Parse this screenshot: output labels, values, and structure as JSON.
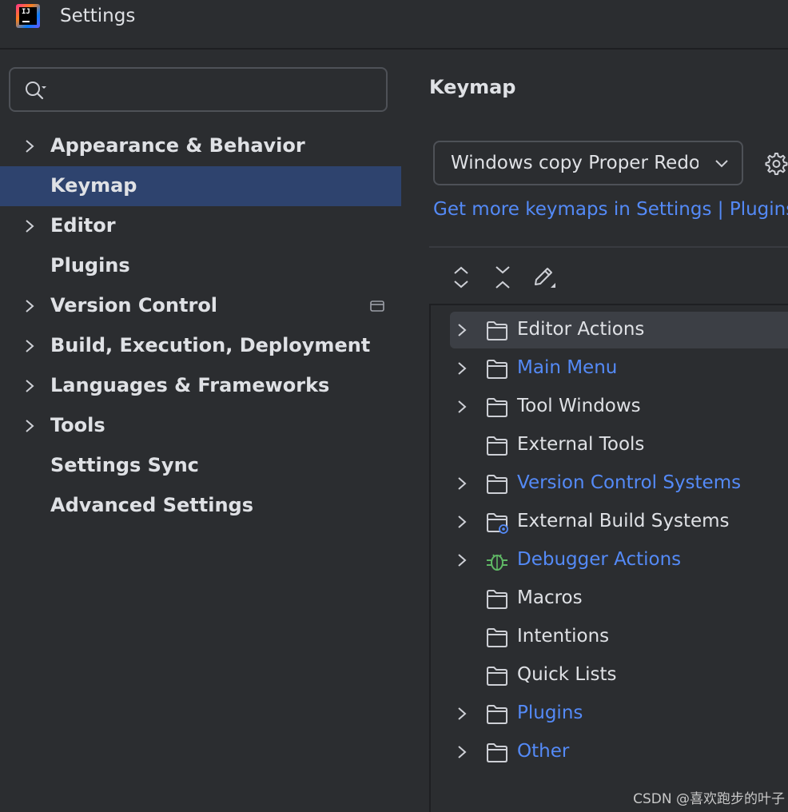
{
  "window": {
    "title": "Settings"
  },
  "search": {
    "placeholder": "",
    "value": ""
  },
  "sidebar": {
    "items": [
      {
        "label": "Appearance & Behavior",
        "expandable": true
      },
      {
        "label": "Keymap",
        "expandable": false,
        "selected": true
      },
      {
        "label": "Editor",
        "expandable": true
      },
      {
        "label": "Plugins",
        "expandable": false
      },
      {
        "label": "Version Control",
        "expandable": true
      },
      {
        "label": "Build, Execution, Deployment",
        "expandable": true
      },
      {
        "label": "Languages & Frameworks",
        "expandable": true
      },
      {
        "label": "Tools",
        "expandable": true
      },
      {
        "label": "Settings Sync",
        "expandable": false
      },
      {
        "label": "Advanced Settings",
        "expandable": false
      }
    ]
  },
  "main": {
    "title": "Keymap",
    "keymap_select": {
      "value": "Windows copy Proper Redo"
    },
    "link": "Get more keymaps in Settings | Plugins",
    "toolbar": {
      "expand_all_icon": "expand-all-icon",
      "collapse_all_icon": "collapse-all-icon",
      "edit_icon": "edit-shortcut-icon"
    },
    "tree": [
      {
        "label": "Editor Actions",
        "expandable": true,
        "modified": false,
        "icon": "folder-icon",
        "highlighted": true
      },
      {
        "label": "Main Menu",
        "expandable": true,
        "modified": true,
        "icon": "folder-icon"
      },
      {
        "label": "Tool Windows",
        "expandable": true,
        "modified": false,
        "icon": "folder-icon"
      },
      {
        "label": "External Tools",
        "expandable": false,
        "modified": false,
        "icon": "folder-icon"
      },
      {
        "label": "Version Control Systems",
        "expandable": true,
        "modified": true,
        "icon": "folder-icon"
      },
      {
        "label": "External Build Systems",
        "expandable": true,
        "modified": false,
        "icon": "folder-gear-icon"
      },
      {
        "label": "Debugger Actions",
        "expandable": true,
        "modified": true,
        "icon": "bug-icon"
      },
      {
        "label": "Macros",
        "expandable": false,
        "modified": false,
        "icon": "folder-icon"
      },
      {
        "label": "Intentions",
        "expandable": false,
        "modified": false,
        "icon": "folder-icon"
      },
      {
        "label": "Quick Lists",
        "expandable": false,
        "modified": false,
        "icon": "folder-icon"
      },
      {
        "label": "Plugins",
        "expandable": true,
        "modified": true,
        "icon": "folder-icon"
      },
      {
        "label": "Other",
        "expandable": true,
        "modified": true,
        "icon": "folder-icon"
      }
    ]
  },
  "watermark": "CSDN @喜欢跑步的叶子",
  "colors": {
    "background": "#2b2d30",
    "selection": "#2e436e",
    "link": "#548af7",
    "text": "#dfe1e5",
    "bug": "#5fb865"
  }
}
